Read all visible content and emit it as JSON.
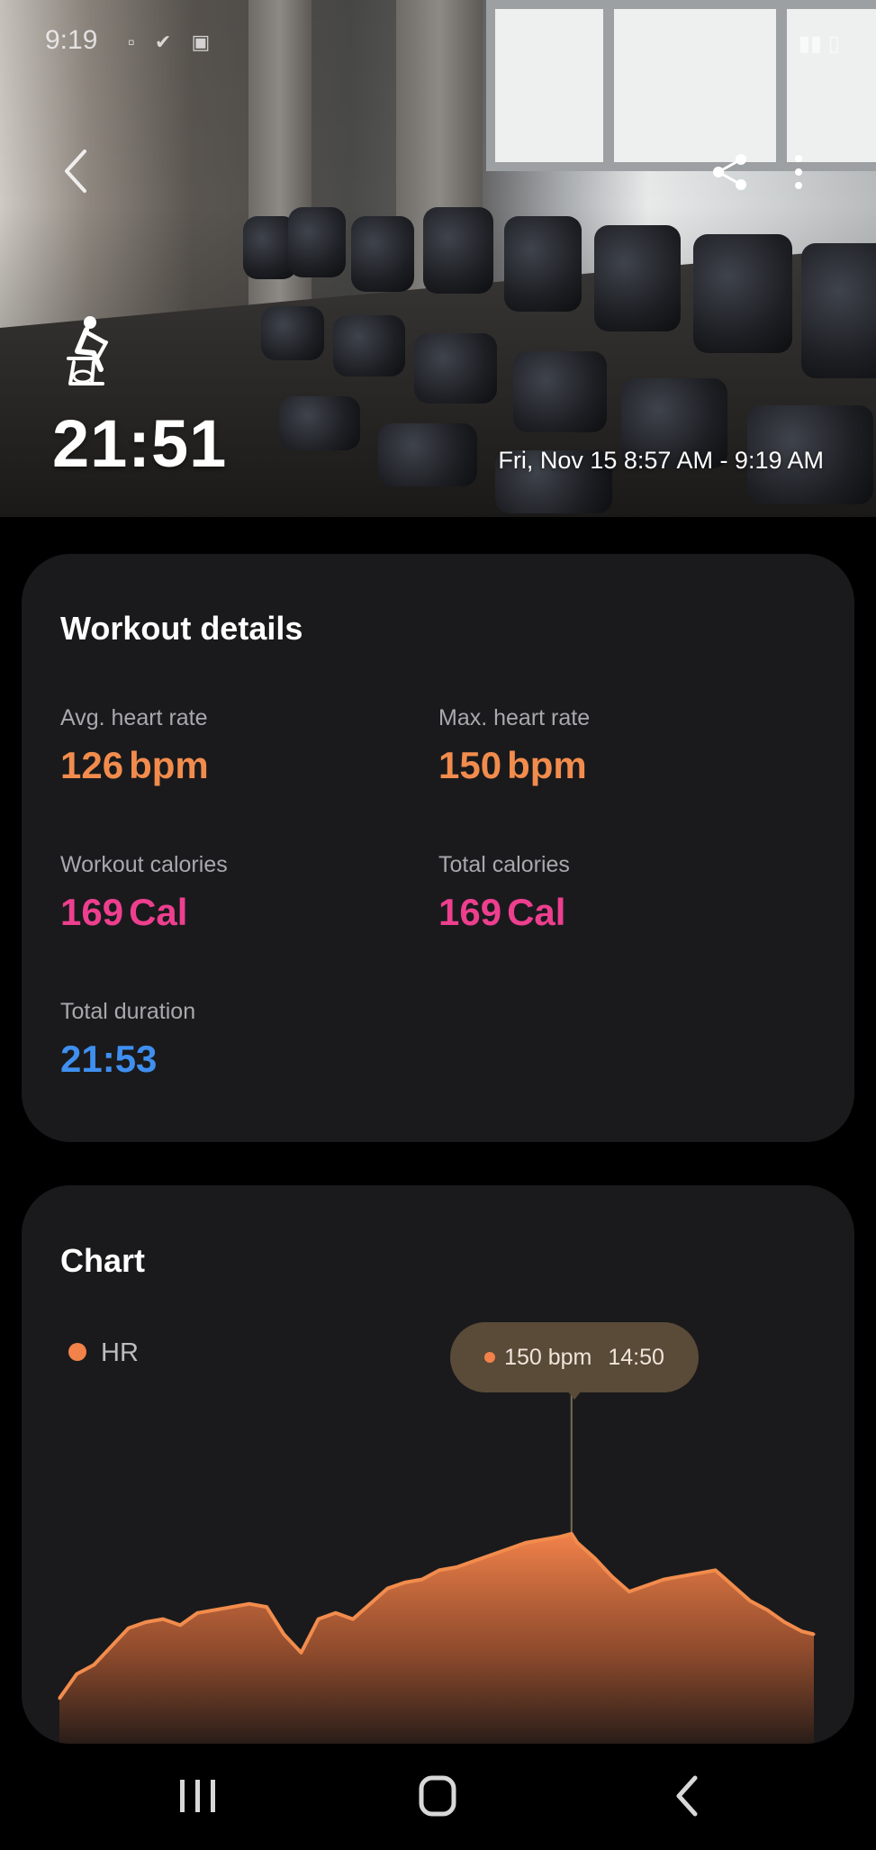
{
  "status_bar": {
    "time": "9:19"
  },
  "header": {
    "workout_icon": "stationary-bike-icon",
    "duration": "21:51",
    "time_range": "Fri, Nov 15 8:57 AM - 9:19 AM"
  },
  "details": {
    "title": "Workout details",
    "avg_hr": {
      "label": "Avg. heart rate",
      "value": "126",
      "unit": "bpm"
    },
    "max_hr": {
      "label": "Max. heart rate",
      "value": "150",
      "unit": "bpm"
    },
    "workout_cal": {
      "label": "Workout calories",
      "value": "169",
      "unit": "Cal"
    },
    "total_cal": {
      "label": "Total calories",
      "value": "169",
      "unit": "Cal"
    },
    "total_duration": {
      "label": "Total duration",
      "value": "21:53"
    }
  },
  "chart_card": {
    "title": "Chart",
    "legend": "HR",
    "tooltip_value": "150 bpm",
    "tooltip_time": "14:50"
  },
  "colors": {
    "hr": "#f28c4d",
    "calories": "#ee3f8f",
    "duration": "#3f8ff0",
    "card_bg": "#1a1a1c"
  },
  "chart_data": {
    "type": "area",
    "series": [
      {
        "name": "HR",
        "x_min": [
          0,
          0.5,
          1,
          1.5,
          2,
          2.5,
          3,
          3.5,
          4,
          4.5,
          5,
          5.5,
          6,
          6.5,
          7,
          7.5,
          8,
          8.5,
          9,
          9.5,
          10,
          10.5,
          11,
          11.5,
          12,
          12.5,
          13,
          13.5,
          14,
          14.5,
          14.83,
          15,
          15.5,
          16,
          16.5,
          17,
          17.5,
          18,
          18.5,
          19,
          19.5,
          20,
          20.5,
          21,
          21.5,
          21.85
        ],
        "values": [
          96,
          104,
          107,
          113,
          119,
          121,
          122,
          120,
          124,
          125,
          126,
          127,
          126,
          117,
          111,
          122,
          124,
          122,
          127,
          132,
          134,
          135,
          138,
          139,
          141,
          143,
          145,
          147,
          148,
          149,
          150,
          147,
          142,
          136,
          131,
          133,
          135,
          136,
          137,
          138,
          133,
          128,
          125,
          121,
          118,
          117
        ]
      }
    ],
    "highlight": {
      "x": "14:50",
      "value": 150
    }
  }
}
